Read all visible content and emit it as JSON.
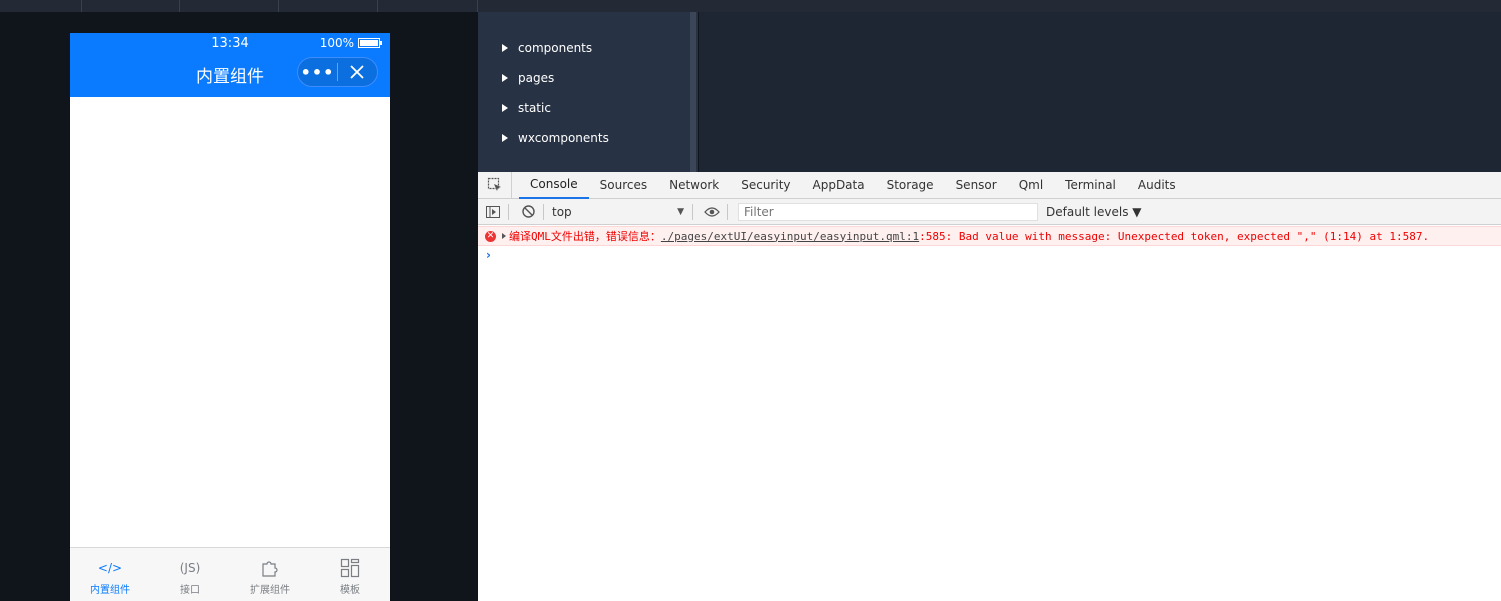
{
  "simulator": {
    "status_time": "13:34",
    "battery": "100%",
    "nav_title": "内置组件",
    "capsule_menu": "•••",
    "accent": "#0a7bff",
    "tabs": [
      {
        "label": "内置组件",
        "icon": "code-icon",
        "glyph": "</>"
      },
      {
        "label": "接口",
        "icon": "js-icon",
        "glyph": "(JS)"
      },
      {
        "label": "扩展组件",
        "icon": "puzzle-icon",
        "glyph": ""
      },
      {
        "label": "模板",
        "icon": "template-icon",
        "glyph": ""
      }
    ]
  },
  "file_tree": {
    "items": [
      {
        "label": "components"
      },
      {
        "label": "pages"
      },
      {
        "label": "static"
      },
      {
        "label": "wxcomponents"
      }
    ]
  },
  "devtools": {
    "tabs": [
      {
        "label": "Console"
      },
      {
        "label": "Sources"
      },
      {
        "label": "Network"
      },
      {
        "label": "Security"
      },
      {
        "label": "AppData"
      },
      {
        "label": "Storage"
      },
      {
        "label": "Sensor"
      },
      {
        "label": "Qml"
      },
      {
        "label": "Terminal"
      },
      {
        "label": "Audits"
      }
    ],
    "context": "top",
    "filter_placeholder": "Filter",
    "levels": "Default levels ▼",
    "error": {
      "prefix": "编译QML文件出错，错误信息：",
      "link": "./pages/extUI/easyinput/easyinput.qml:1",
      "suffix": ":585: Bad value with message: Unexpected token, expected \",\" (1:14) at 1:587."
    },
    "prompt": "›"
  }
}
